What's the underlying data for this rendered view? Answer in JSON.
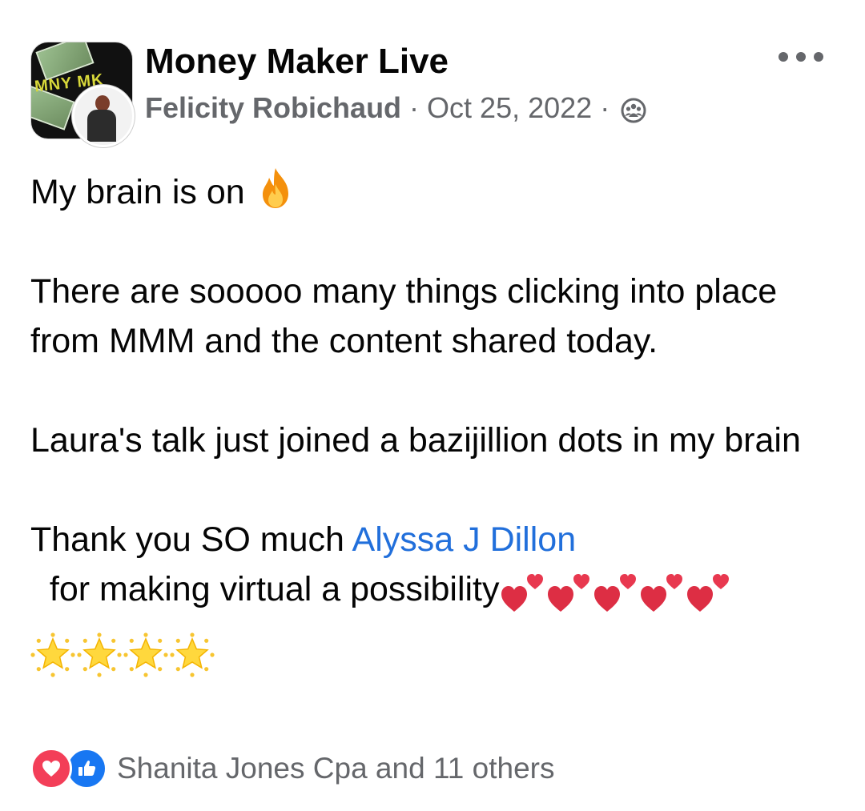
{
  "header": {
    "group_name": "Money Maker Live",
    "group_logo_text": "MNY MK",
    "author": "Felicity Robichaud",
    "separator": "·",
    "date": "Oct 25, 2022",
    "privacy_icon": "group-members-icon",
    "more_icon": "more-options-icon"
  },
  "post": {
    "line1": "My brain is on",
    "line1_emoji": "fire-icon",
    "para2": "There are sooooo many things clicking into place from MMM and the content shared today.",
    "para3": "Laura's talk just joined a bazijillion dots in my brain",
    "para4_before": "Thank you SO much ",
    "mention": "Alyssa J Dillon",
    "para4_after": "  for making virtual a possibility",
    "trailing_emojis": [
      "heart-icon",
      "heart-icon",
      "heart-icon",
      "heart-icon",
      "heart-icon",
      "star-icon",
      "star-icon",
      "star-icon",
      "star-icon"
    ]
  },
  "reactions": {
    "icons": [
      "love-reaction-icon",
      "like-reaction-icon"
    ],
    "summary": "Shanita Jones Cpa and 11 others"
  },
  "colors": {
    "text": "#050505",
    "secondary": "#65676b",
    "link": "#216fdb",
    "love": "#f33e58",
    "like": "#1877f2"
  }
}
